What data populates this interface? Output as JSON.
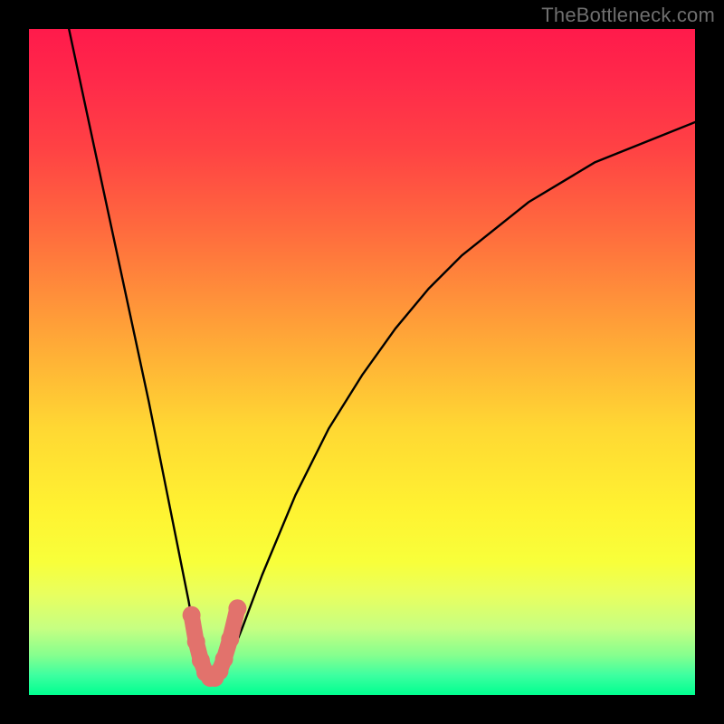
{
  "watermark": "TheBottleneck.com",
  "chart_data": {
    "type": "line",
    "title": "",
    "xlabel": "",
    "ylabel": "",
    "xlim": [
      0,
      100
    ],
    "ylim": [
      0,
      100
    ],
    "curve": {
      "name": "bottleneck-curve",
      "x": [
        6,
        9,
        12,
        15,
        18,
        20,
        22,
        24,
        25,
        26,
        27,
        28,
        29,
        30,
        32,
        35,
        40,
        45,
        50,
        55,
        60,
        65,
        70,
        75,
        80,
        85,
        90,
        95,
        100
      ],
      "y": [
        100,
        86,
        72,
        58,
        44,
        34,
        24,
        14,
        8,
        4,
        2,
        2,
        3,
        5,
        10,
        18,
        30,
        40,
        48,
        55,
        61,
        66,
        70,
        74,
        77,
        80,
        82,
        84,
        86
      ]
    },
    "highlight_segment": {
      "name": "valley-highlight",
      "x": [
        24.4,
        25.1,
        25.8,
        26.5,
        27.2,
        27.9,
        28.6,
        29.3,
        30.2,
        31.3
      ],
      "y": [
        12.0,
        8.0,
        5.2,
        3.4,
        2.6,
        2.6,
        3.6,
        5.4,
        8.4,
        13.0
      ]
    },
    "colors": {
      "curve": "#000000",
      "highlight": "#e2726c",
      "gradient_top": "#ff1a4b",
      "gradient_bottom": "#00ff90"
    }
  }
}
